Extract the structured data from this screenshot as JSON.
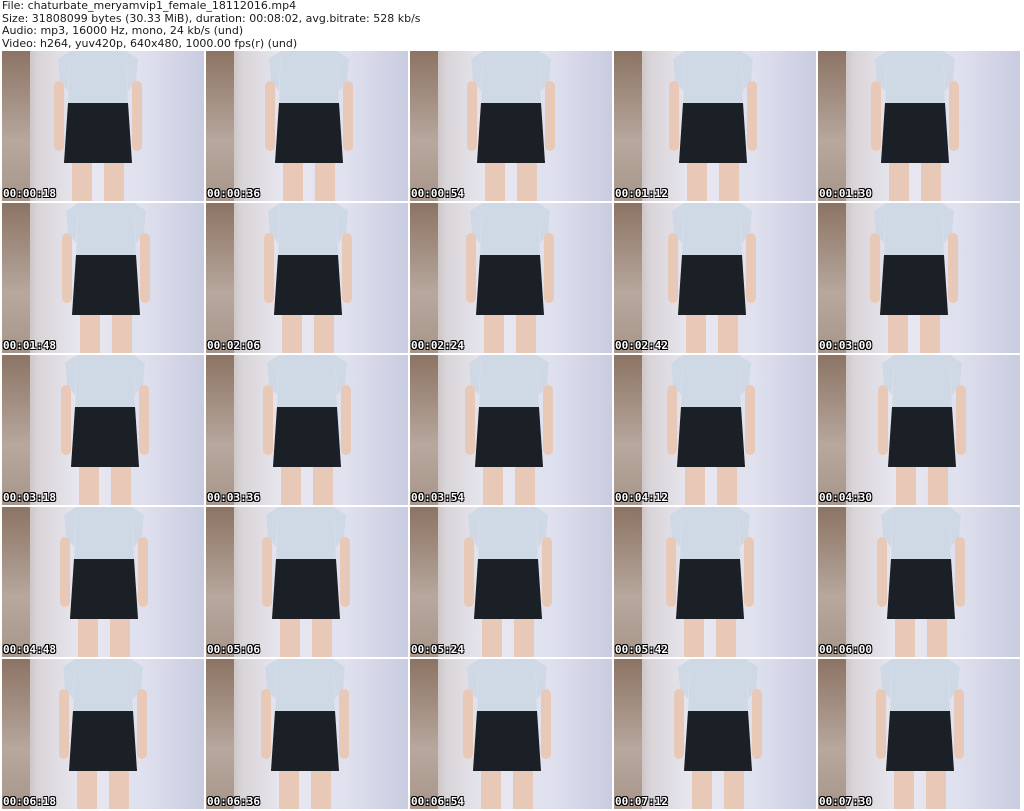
{
  "header": {
    "line1": "File: chaturbate_meryamvip1_female_18112016.mp4",
    "line2": "Size: 31808099 bytes (30.33 MiB), duration: 00:08:02, avg.bitrate: 528 kb/s",
    "line3": "Audio: mp3, 16000 Hz, mono, 24 kb/s (und)",
    "line4": "Video: h264, yuv420p, 640x480, 1000.00 fps(r) (und)"
  },
  "thumbnails": [
    {
      "timestamp": "00:00:18"
    },
    {
      "timestamp": "00:00:36"
    },
    {
      "timestamp": "00:00:54"
    },
    {
      "timestamp": "00:01:12"
    },
    {
      "timestamp": "00:01:30"
    },
    {
      "timestamp": "00:01:48"
    },
    {
      "timestamp": "00:02:06"
    },
    {
      "timestamp": "00:02:24"
    },
    {
      "timestamp": "00:02:42"
    },
    {
      "timestamp": "00:03:00"
    },
    {
      "timestamp": "00:03:18"
    },
    {
      "timestamp": "00:03:36"
    },
    {
      "timestamp": "00:03:54"
    },
    {
      "timestamp": "00:04:12"
    },
    {
      "timestamp": "00:04:30"
    },
    {
      "timestamp": "00:04:48"
    },
    {
      "timestamp": "00:05:06"
    },
    {
      "timestamp": "00:05:24"
    },
    {
      "timestamp": "00:05:42"
    },
    {
      "timestamp": "00:06:00"
    },
    {
      "timestamp": "00:06:18"
    },
    {
      "timestamp": "00:06:36"
    },
    {
      "timestamp": "00:06:54"
    },
    {
      "timestamp": "00:07:12"
    },
    {
      "timestamp": "00:07:30"
    }
  ],
  "colors": {
    "blouse": "#cfd9e6",
    "skirt": "#1b1f26",
    "skin": "#e8c9b8",
    "timestamp": "#ffffff"
  }
}
